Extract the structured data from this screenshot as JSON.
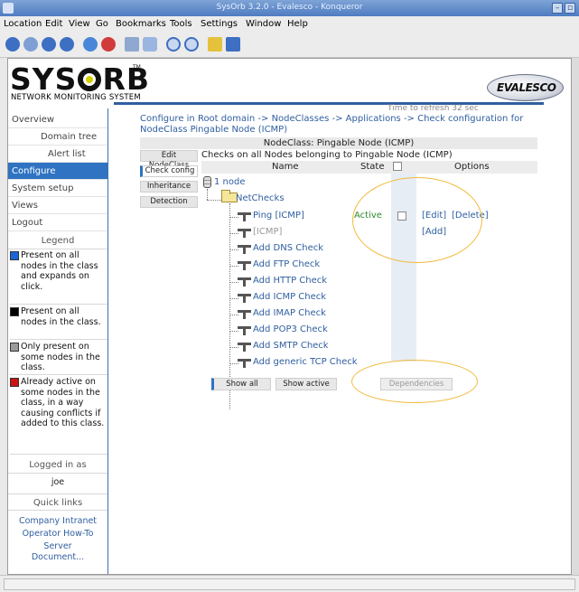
{
  "window": {
    "title": "SysOrb 3.2.0 - Evalesco - Konqueror",
    "controls": [
      "–",
      "▫"
    ]
  },
  "menubar": [
    "Location",
    "Edit",
    "View",
    "Go",
    "Bookmarks",
    "Tools",
    "Settings",
    "Window",
    "Help"
  ],
  "toolbar": {
    "icons": [
      "back-icon",
      "forward-icon",
      "up-icon",
      "home-icon",
      "reload-icon",
      "stop-icon",
      "print-icon",
      "security-icon",
      "zoom-in-icon",
      "zoom-out-icon",
      "lock-icon",
      "download-icon"
    ]
  },
  "header": {
    "logo": "SYSORB",
    "trademark": "TM",
    "subtitle": "NETWORK MONITORING SYSTEM",
    "refresh": "Time to refresh 32 sec",
    "partner_logo": "EVALESCO"
  },
  "sidebar": {
    "items": [
      {
        "label": "Overview",
        "indent": false,
        "selected": false
      },
      {
        "label": "Domain tree",
        "indent": true,
        "selected": false
      },
      {
        "label": "Alert list",
        "indent": true,
        "selected": false
      },
      {
        "label": "Configure",
        "indent": false,
        "selected": true
      },
      {
        "label": "System setup",
        "indent": false,
        "selected": false
      },
      {
        "label": "Views",
        "indent": false,
        "selected": false
      },
      {
        "label": "Logout",
        "indent": false,
        "selected": false
      }
    ],
    "legend_title": "Legend",
    "legend": [
      {
        "color": "#1a66d9",
        "text": "Present on all nodes in the class and expands on click."
      },
      {
        "color": "#000000",
        "text": "Present on all nodes in the class."
      },
      {
        "color": "#9a9a9a",
        "text": "Only present on some nodes in the class."
      },
      {
        "color": "#cc1111",
        "text": "Already active on some nodes in the class, in a way causing conflicts if added to this class."
      }
    ],
    "logged_in_title": "Logged in as",
    "user": "joe",
    "quick_links_title": "Quick links",
    "quick_links": [
      "Company Intranet",
      "Operator How-To",
      "Server Document..."
    ]
  },
  "main": {
    "breadcrumb": "Configure in Root domain -> NodeClasses -> Applications -> Check configuration for NodeClass Pingable Node (ICMP)",
    "nodeclass_header": "NodeClass: Pingable Node (ICMP)",
    "tabs": [
      "Edit NodeClass",
      "Check config",
      "Inheritance",
      "Detection"
    ],
    "selected_tab": "Check config",
    "checks_title": "Checks on all Nodes belonging to Pingable Node (ICMP)",
    "columns": {
      "name": "Name",
      "state": "State",
      "options": "Options"
    },
    "tree": {
      "root": "1 node",
      "folder": "NetChecks",
      "items": [
        {
          "label": "Ping [ICMP]",
          "grey": false
        },
        {
          "label": "[ICMP]",
          "grey": true
        },
        {
          "label": "Add DNS Check",
          "grey": false
        },
        {
          "label": "Add FTP Check",
          "grey": false
        },
        {
          "label": "Add HTTP Check",
          "grey": false
        },
        {
          "label": "Add ICMP Check",
          "grey": false
        },
        {
          "label": "Add IMAP Check",
          "grey": false
        },
        {
          "label": "Add POP3 Check",
          "grey": false
        },
        {
          "label": "Add SMTP Check",
          "grey": false
        },
        {
          "label": "Add generic TCP Check",
          "grey": false
        }
      ]
    },
    "row_state": "Active",
    "options": {
      "edit": "[Edit]",
      "delete": "[Delete]",
      "add": "[Add]"
    },
    "buttons": {
      "show_all": "Show all",
      "show_active": "Show active",
      "dependencies": "Dependencies"
    },
    "colors": {
      "link": "#2f5f9f",
      "nav_selected": "#2f73c2",
      "highlight": "#f0b93a",
      "active": "#2e8b2e"
    }
  }
}
